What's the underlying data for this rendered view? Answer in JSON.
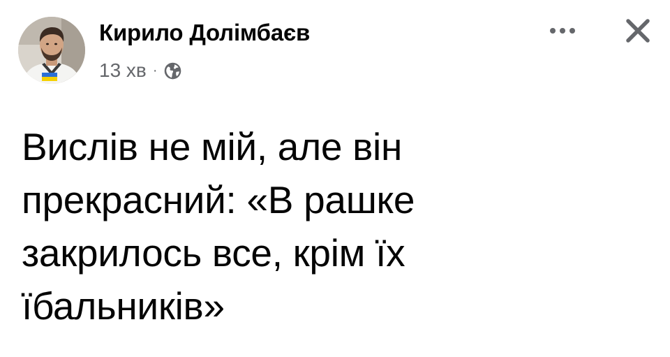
{
  "post": {
    "author": {
      "name": "Кирило Долімбаєв",
      "avatar_icon": "profile-photo"
    },
    "meta": {
      "time": "13 хв",
      "separator": "·",
      "audience_icon": "globe-icon"
    },
    "actions": {
      "more_icon": "more-horizontal-icon",
      "close_icon": "close-icon"
    },
    "text": "Вислів не мій, але він\nпрекрасний: «В рашке\nзакрилось все, крім їх\nїбальників»"
  },
  "colors": {
    "text": "#050505",
    "secondary_text": "#65676b",
    "background": "#ffffff",
    "flag_blue": "#2b6fd6",
    "flag_yellow": "#f5d000"
  }
}
